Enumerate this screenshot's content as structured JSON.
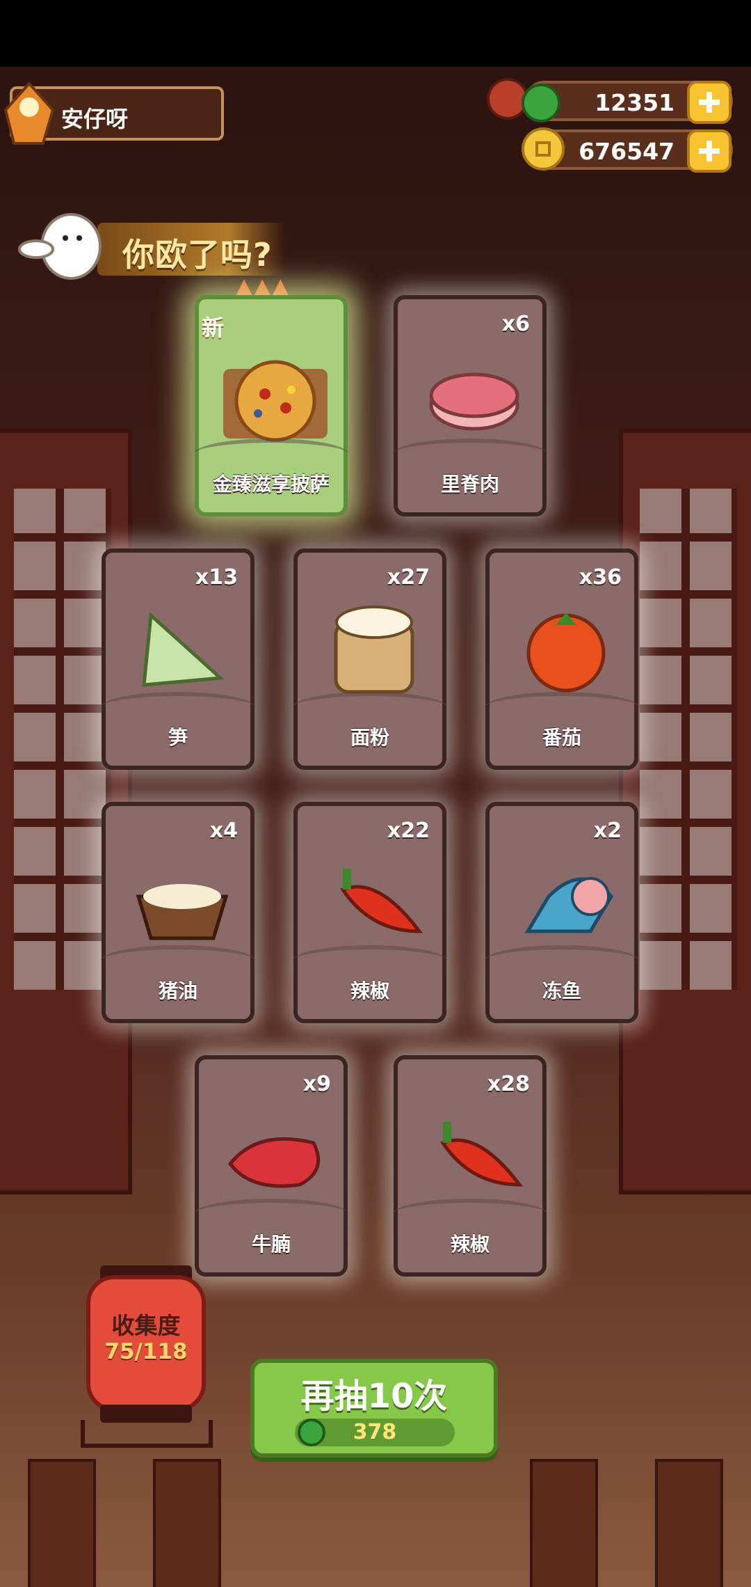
{
  "player": {
    "name": "安仔呀"
  },
  "currency": {
    "gems": {
      "value": "12351",
      "icon": "jade-coin-icon"
    },
    "coins": {
      "value": "676547",
      "icon": "gold-coin-icon"
    }
  },
  "banner": {
    "title": "你欧了吗?"
  },
  "featured_card": {
    "badge": "新",
    "label": "金臻滋享披萨",
    "rarity_flames": 3
  },
  "cards": [
    {
      "label": "里脊肉",
      "count": "x6",
      "icon": "pork-loin-icon"
    },
    {
      "label": "笋",
      "count": "x13",
      "icon": "bamboo-shoot-icon"
    },
    {
      "label": "面粉",
      "count": "x27",
      "icon": "flour-sack-icon"
    },
    {
      "label": "番茄",
      "count": "x36",
      "icon": "tomato-icon"
    },
    {
      "label": "猪油",
      "count": "x4",
      "icon": "lard-bowl-icon"
    },
    {
      "label": "辣椒",
      "count": "x22",
      "icon": "chili-pepper-icon"
    },
    {
      "label": "冻鱼",
      "count": "x2",
      "icon": "frozen-fish-icon"
    },
    {
      "label": "牛腩",
      "count": "x9",
      "icon": "beef-brisket-icon"
    },
    {
      "label": "辣椒",
      "count": "x28",
      "icon": "chili-pepper-icon"
    }
  ],
  "collection": {
    "title": "收集度",
    "value": "75/118"
  },
  "draw_button": {
    "label": "再抽10次",
    "cost": "378"
  },
  "colors": {
    "accent_green": "#86c84a",
    "card_bg": "#8b6b69",
    "banner_text": "#ffe9a4"
  }
}
